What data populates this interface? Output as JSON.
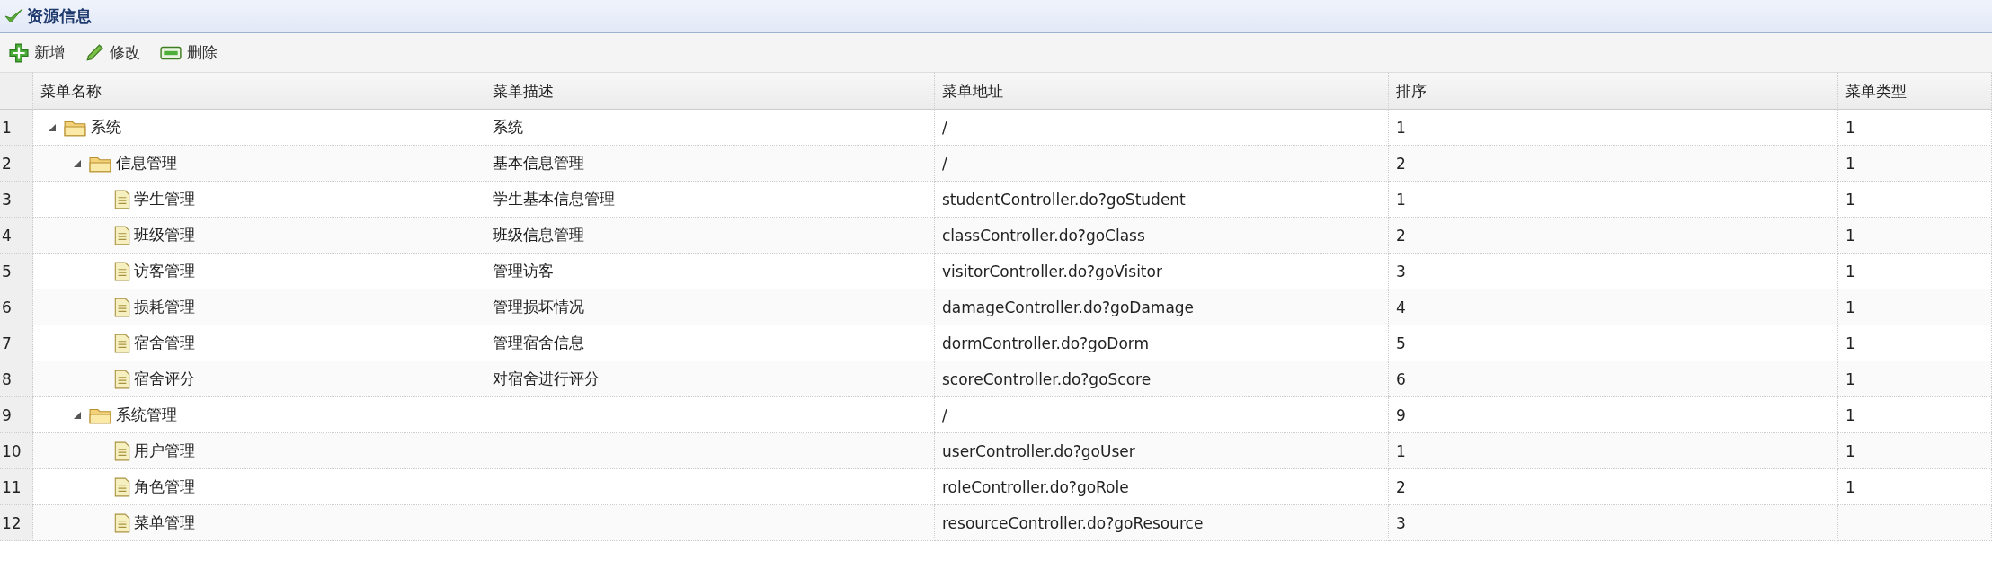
{
  "panel": {
    "title": "资源信息"
  },
  "toolbar": [
    {
      "kind": "add",
      "label": "新增"
    },
    {
      "kind": "edit",
      "label": "修改"
    },
    {
      "kind": "delete",
      "label": "删除"
    }
  ],
  "table": {
    "columns": [
      "菜单名称",
      "菜单描述",
      "菜单地址",
      "排序",
      "菜单类型"
    ],
    "rows": [
      {
        "row_number": "1",
        "name": "系统",
        "description": "系统",
        "url": "/",
        "sort": "1",
        "type": "1",
        "expanded": true,
        "children": [
          {
            "row_number": "2",
            "name": "信息管理",
            "description": "基本信息管理",
            "url": "/",
            "sort": "2",
            "type": "1",
            "expanded": true,
            "children": [
              {
                "row_number": "3",
                "name": "学生管理",
                "description": "学生基本信息管理",
                "url": "studentController.do?goStudent",
                "sort": "1",
                "type": "1"
              },
              {
                "row_number": "4",
                "name": "班级管理",
                "description": "班级信息管理",
                "url": "classController.do?goClass",
                "sort": "2",
                "type": "1"
              },
              {
                "row_number": "5",
                "name": "访客管理",
                "description": "管理访客",
                "url": "visitorController.do?goVisitor",
                "sort": "3",
                "type": "1"
              },
              {
                "row_number": "6",
                "name": "损耗管理",
                "description": "管理损坏情况",
                "url": "damageController.do?goDamage",
                "sort": "4",
                "type": "1"
              },
              {
                "row_number": "7",
                "name": "宿舍管理",
                "description": "管理宿舍信息",
                "url": "dormController.do?goDorm",
                "sort": "5",
                "type": "1"
              },
              {
                "row_number": "8",
                "name": "宿舍评分",
                "description": "对宿舍进行评分",
                "url": "scoreController.do?goScore",
                "sort": "6",
                "type": "1"
              }
            ]
          },
          {
            "row_number": "9",
            "name": "系统管理",
            "url": "/",
            "sort": "9",
            "type": "1",
            "expanded": true,
            "children": [
              {
                "row_number": "10",
                "name": "用户管理",
                "url": "userController.do?goUser",
                "sort": "1",
                "type": "1"
              },
              {
                "row_number": "11",
                "name": "角色管理",
                "url": "roleController.do?goRole",
                "sort": "2",
                "type": "1"
              },
              {
                "row_number": "12",
                "name": "菜单管理",
                "url": "resourceController.do?goResource",
                "sort": "3"
              }
            ]
          }
        ]
      }
    ]
  }
}
